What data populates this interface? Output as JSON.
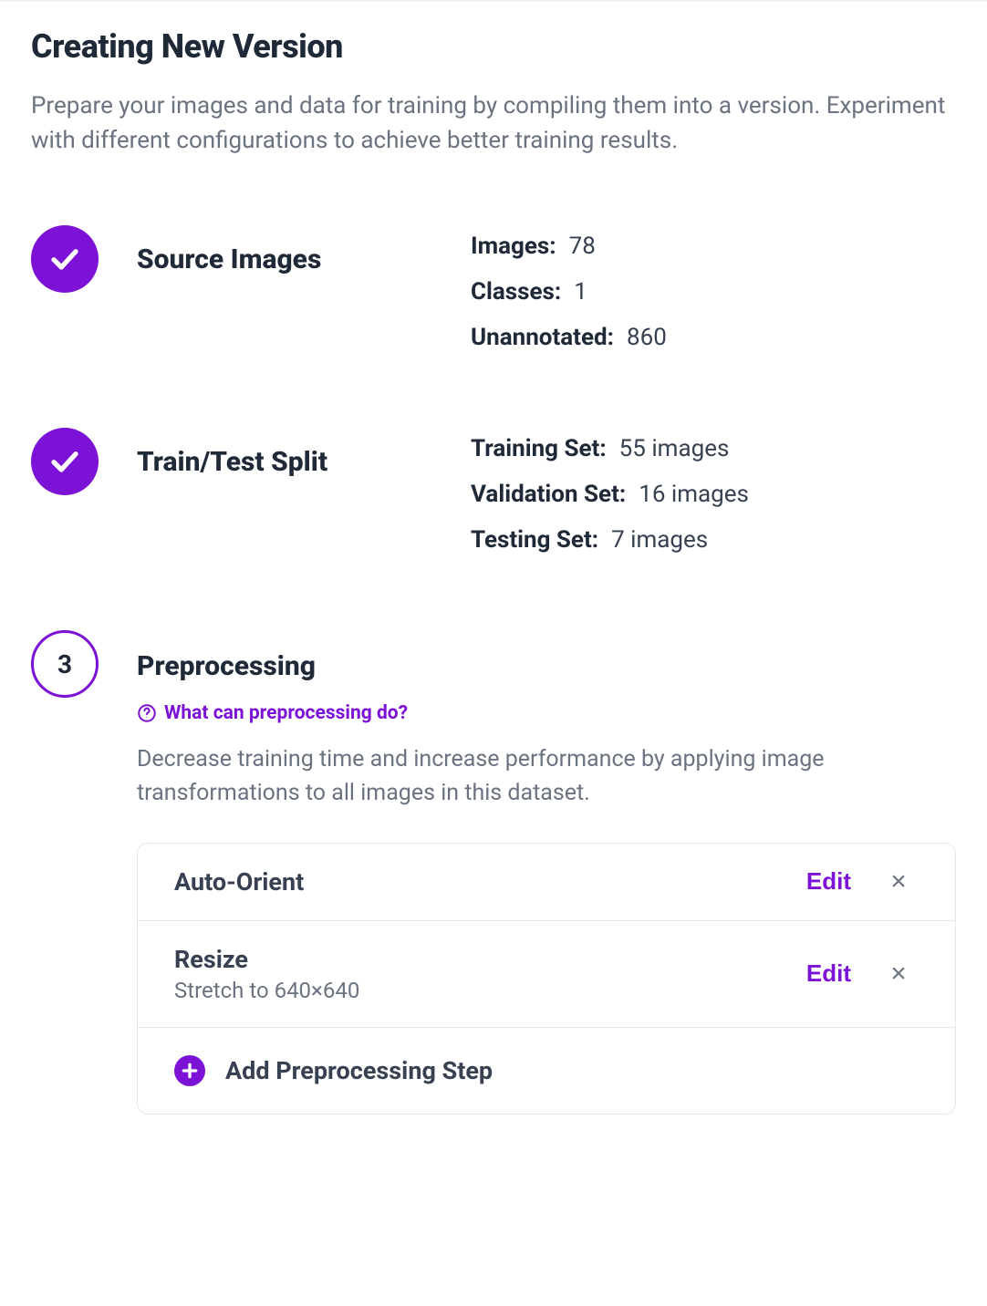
{
  "header": {
    "title": "Creating New Version",
    "description": "Prepare your images and data for training by compiling them into a version. Experiment with different configurations to achieve better training results."
  },
  "steps": {
    "source_images": {
      "title": "Source Images",
      "stats": {
        "images_label": "Images:",
        "images_value": "78",
        "classes_label": "Classes:",
        "classes_value": "1",
        "unannotated_label": "Unannotated:",
        "unannotated_value": "860"
      }
    },
    "split": {
      "title": "Train/Test Split",
      "stats": {
        "train_label": "Training Set:",
        "train_value": "55 images",
        "val_label": "Validation Set:",
        "val_value": "16 images",
        "test_label": "Testing Set:",
        "test_value": "7 images"
      }
    },
    "preprocessing": {
      "number": "3",
      "title": "Preprocessing",
      "help_text": "What can preprocessing do?",
      "description": "Decrease training time and increase performance by applying image transformations to all images in this dataset.",
      "items": [
        {
          "name": "Auto-Orient",
          "sub": "",
          "edit": "Edit"
        },
        {
          "name": "Resize",
          "sub": "Stretch to 640×640",
          "edit": "Edit"
        }
      ],
      "add_label": "Add Preprocessing Step"
    }
  }
}
